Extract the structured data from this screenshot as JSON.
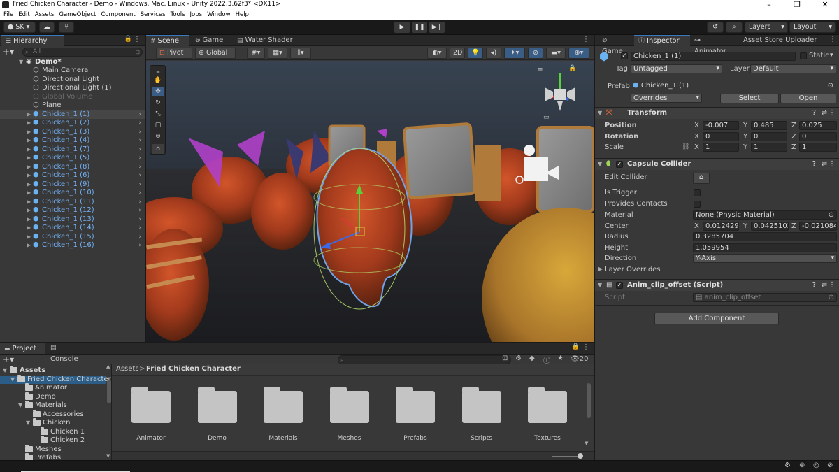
{
  "window": {
    "title": "Fried Chicken Character - Demo - Windows, Mac, Linux - Unity 2022.3.62f3* <DX11>"
  },
  "menu": [
    "File",
    "Edit",
    "Assets",
    "GameObject",
    "Component",
    "Services",
    "Tools",
    "Jobs",
    "Window",
    "Help"
  ],
  "toolbar": {
    "account": "SK",
    "layers_label": "Layers",
    "layout_label": "Layout"
  },
  "hierarchy": {
    "tab": "Hierarchy",
    "search_placeholder": "All",
    "scene": "Demo*",
    "items": [
      {
        "label": "Main Camera",
        "style": "normal"
      },
      {
        "label": "Directional Light",
        "style": "normal"
      },
      {
        "label": "Directional Light (1)",
        "style": "normal"
      },
      {
        "label": "Global Volume",
        "style": "dim"
      },
      {
        "label": "Plane",
        "style": "normal"
      },
      {
        "label": "Chicken_1 (1)",
        "style": "selected"
      },
      {
        "label": "Chicken_1 (2)",
        "style": "prefab"
      },
      {
        "label": "Chicken_1 (3)",
        "style": "prefab"
      },
      {
        "label": "Chicken_1 (4)",
        "style": "prefab"
      },
      {
        "label": "Chicken_1 (7)",
        "style": "prefab"
      },
      {
        "label": "Chicken_1 (5)",
        "style": "prefab"
      },
      {
        "label": "Chicken_1 (8)",
        "style": "prefab"
      },
      {
        "label": "Chicken_1 (6)",
        "style": "prefab"
      },
      {
        "label": "Chicken_1 (9)",
        "style": "prefab"
      },
      {
        "label": "Chicken_1 (10)",
        "style": "prefab"
      },
      {
        "label": "Chicken_1 (11)",
        "style": "prefab"
      },
      {
        "label": "Chicken_1 (12)",
        "style": "prefab"
      },
      {
        "label": "Chicken_1 (13)",
        "style": "prefab"
      },
      {
        "label": "Chicken_1 (14)",
        "style": "prefab"
      },
      {
        "label": "Chicken_1 (15)",
        "style": "prefab"
      },
      {
        "label": "Chicken_1 (16)",
        "style": "prefab"
      }
    ]
  },
  "scene_view": {
    "tabs": [
      "Scene",
      "Game",
      "Water Shader"
    ],
    "pivot": "Pivot",
    "global": "Global",
    "mode_2d": "2D"
  },
  "inspector": {
    "tabs": [
      "Game",
      "Inspector",
      "Animator",
      "Asset Store Uploader"
    ],
    "object_name": "Chicken_1 (1)",
    "static_label": "Static",
    "tag_label": "Tag",
    "tag_value": "Untagged",
    "layer_label": "Layer",
    "layer_value": "Default",
    "prefab_label": "Prefab",
    "prefab_value": "Chicken_1 (1)",
    "overrides": "Overrides",
    "select": "Select",
    "open": "Open",
    "transform": {
      "title": "Transform",
      "position_label": "Position",
      "rotation_label": "Rotation",
      "scale_label": "Scale",
      "position": {
        "x": "-0.007",
        "y": "0.485",
        "z": "0.025"
      },
      "rotation": {
        "x": "0",
        "y": "0",
        "z": "0"
      },
      "scale": {
        "x": "1",
        "y": "1",
        "z": "1"
      }
    },
    "capsule": {
      "title": "Capsule Collider",
      "edit_collider": "Edit Collider",
      "is_trigger": "Is Trigger",
      "provides_contacts": "Provides Contacts",
      "material_label": "Material",
      "material_value": "None (Physic Material)",
      "center_label": "Center",
      "center": {
        "x": "0.0124299",
        "y": "0.0425102",
        "z": "-0.021084"
      },
      "radius_label": "Radius",
      "radius": "0.3285704",
      "height_label": "Height",
      "height": "1.059954",
      "direction_label": "Direction",
      "direction": "Y-Axis",
      "layer_overrides": "Layer Overrides"
    },
    "script_comp": {
      "title": "Anim_clip_offset (Script)",
      "script_label": "Script",
      "script_value": "anim_clip_offset"
    },
    "add_component": "Add Component"
  },
  "project": {
    "tabs": [
      "Project",
      "Console"
    ],
    "breadcrumb_root": "Assets",
    "breadcrumb_current": "Fried Chicken Character",
    "visible_count": "20",
    "tree": [
      {
        "label": "Assets",
        "level": 0,
        "bold": true
      },
      {
        "label": "Fried Chicken Character",
        "level": 1,
        "selected": true
      },
      {
        "label": "Animator",
        "level": 2
      },
      {
        "label": "Demo",
        "level": 2
      },
      {
        "label": "Materials",
        "level": 2
      },
      {
        "label": "Accessories",
        "level": 3
      },
      {
        "label": "Chicken",
        "level": 3
      },
      {
        "label": "Chicken 1",
        "level": 4
      },
      {
        "label": "Chicken 2",
        "level": 4
      },
      {
        "label": "Meshes",
        "level": 2
      },
      {
        "label": "Prefabs",
        "level": 2
      }
    ],
    "folders": [
      "Animator",
      "Demo",
      "Materials",
      "Meshes",
      "Prefabs",
      "Scripts",
      "Textures"
    ]
  }
}
